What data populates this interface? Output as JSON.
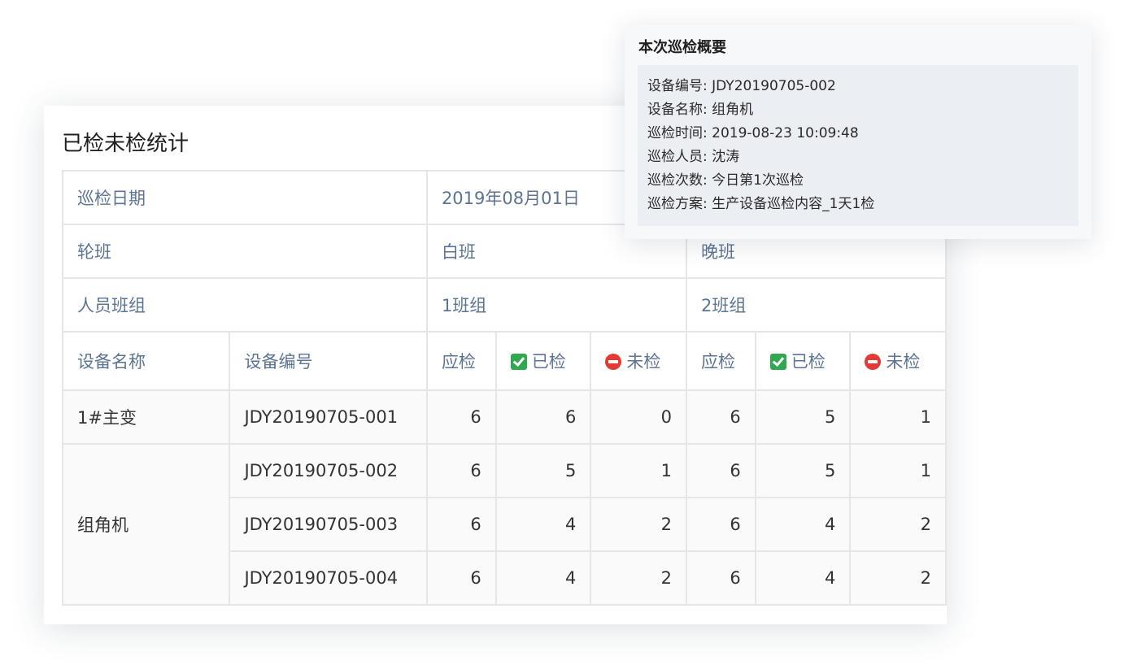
{
  "card": {
    "title": "已检未检统计"
  },
  "table": {
    "date_label": "巡检日期",
    "date_value": "2019年08月01日",
    "shift_label": "轮班",
    "shift_day": "白班",
    "shift_night": "晚班",
    "group_label": "人员班组",
    "group_day": "1班组",
    "group_night": "2班组",
    "columns": {
      "device_name": "设备名称",
      "device_code": "设备编号",
      "should": "应检",
      "done": "已检",
      "undone": "未检"
    },
    "rows": [
      {
        "name": "1#主变",
        "code": "JDY20190705-001",
        "day": {
          "should": "6",
          "done": "6",
          "undone": "0"
        },
        "night": {
          "should": "6",
          "done": "5",
          "undone": "1"
        }
      },
      {
        "name": "组角机",
        "code": "JDY20190705-002",
        "day": {
          "should": "6",
          "done": "5",
          "undone": "1"
        },
        "night": {
          "should": "6",
          "done": "5",
          "undone": "1"
        }
      },
      {
        "code": "JDY20190705-003",
        "day": {
          "should": "6",
          "done": "4",
          "undone": "2"
        },
        "night": {
          "should": "6",
          "done": "4",
          "undone": "2"
        }
      },
      {
        "code": "JDY20190705-004",
        "day": {
          "should": "6",
          "done": "4",
          "undone": "2"
        },
        "night": {
          "should": "6",
          "done": "4",
          "undone": "2"
        }
      }
    ]
  },
  "icons": {
    "done": "check-box-icon",
    "undone": "no-entry-icon"
  },
  "colors": {
    "header_text": "#5c7493",
    "done_icon": "#2fa84f",
    "undone_icon": "#e53935"
  },
  "popup": {
    "title": "本次巡检概要",
    "lines": [
      "设备编号: JDY20190705-002",
      "设备名称: 组角机",
      "巡检时间: 2019-08-23 10:09:48",
      "巡检人员: 沈涛",
      "巡检次数: 今日第1次巡检",
      "巡检方案: 生产设备巡检内容_1天1检"
    ]
  }
}
